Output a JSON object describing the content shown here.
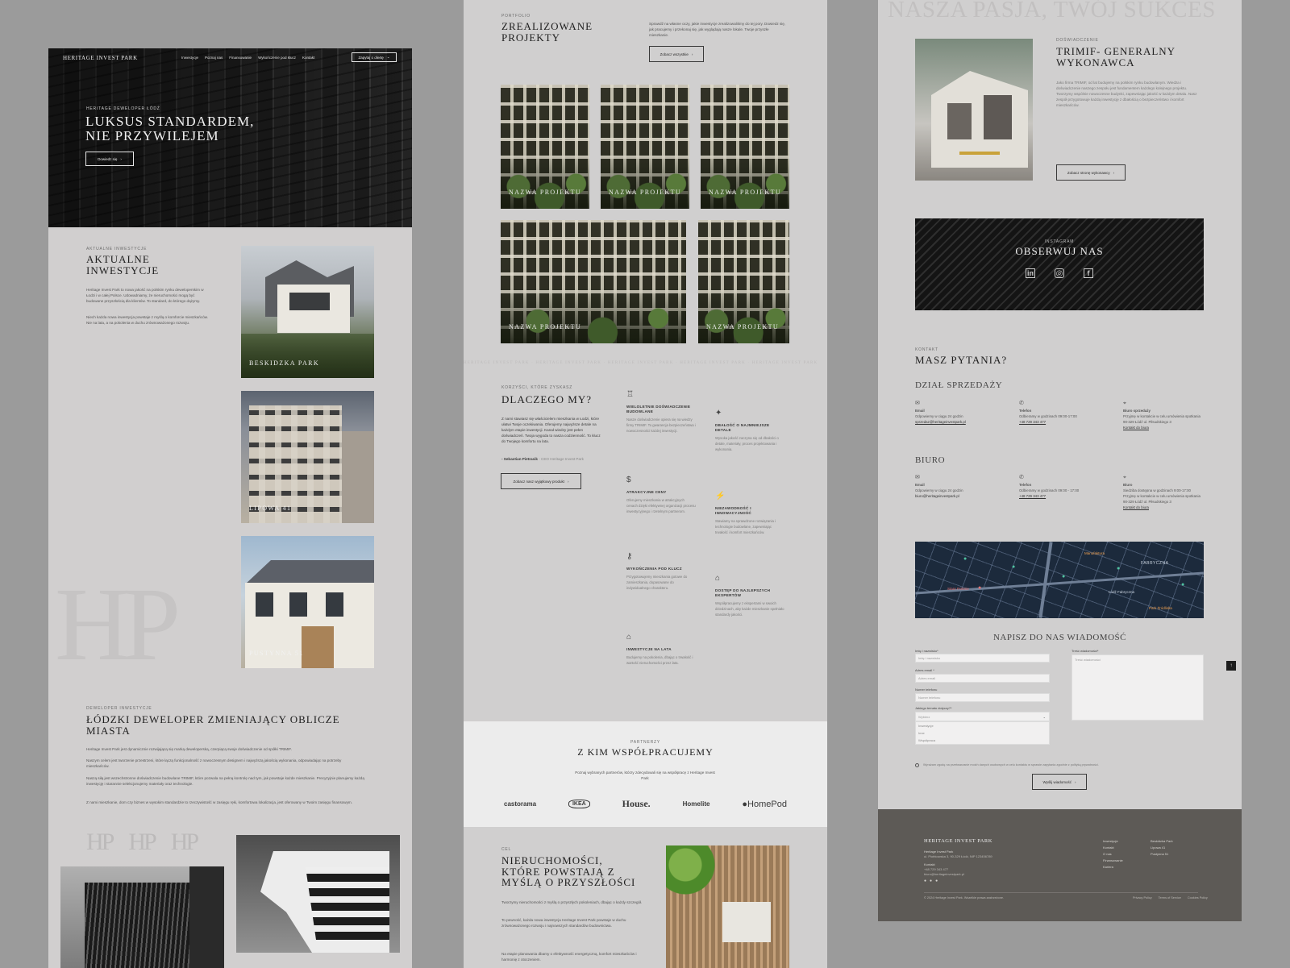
{
  "col1": {
    "header": {
      "logo": "HERITAGE INVEST PARK",
      "nav": [
        "Inwestycje",
        "Poznaj nas",
        "Finansowanie",
        "Wykończenie pod klucz",
        "Kontakt"
      ],
      "cta": "Zapytaj o ofertę"
    },
    "hero": {
      "eyebrow": "HERITAGE DEWELOPER ŁÓDŹ",
      "title_line1": "LUKSUS STANDARDEM,",
      "title_line2": "NIE PRZYWILEJEM",
      "button": "Dowiedz się"
    },
    "current": {
      "eyebrow": "AKTUALNE INWESTYCJE",
      "title_line1": "AKTUALNE",
      "title_line2": "INWESTYCJE",
      "p1": "Heritage Invest Park to nowa jakość na polskim rynku deweloperskim w Łodzi i w całej Polsce. Udowadniamy, że nieruchomości mogą być budowane przyszłością dla klientów. To standard, do którego dążymy.",
      "p2": "Niech każda nowa inwestycja powstaje z myślą o komforcie mieszkańców. Nie na lata, a na pokolenia w duchu zrównoważonego rozwoju.",
      "projects": [
        "BESKIDZKA PARK",
        "LIPOWA 41",
        "PUSTYNNA 51"
      ]
    },
    "developer": {
      "eyebrow": "DEWELOPER INWESTYCJE",
      "title_line1": "ŁÓDZKI DEWELOPER ZMIENIAJĄCY OBLICZE",
      "title_line2": "MIASTA",
      "p1": "Heritage Invest Park jest dynamicznie rozwijającą się marką deweloperską, czerpiącą swoje doświadczenie od spółki TRIMIF.",
      "p2": "Naszym celem jest tworzenie przestrzeni, które łączą funkcjonalność z nowoczesnym designem i najwyższą jakością wykonania, odpowiadając na potrzeby mieszkańców.",
      "p3": "Naszą siłą jest wszechstronne doświadczenie budowlane TRIMIF, które pozwala na pełną kontrolę nad tym, jak powstaje każde mieszkanie. Precyzyjnie planujemy każdą inwestycję i starannie selekcjonujemy materiały oraz technologie.",
      "p4": "Z nami mieszkanie, dom czy biznes w wysokim standardzie to rzeczywistość w zasięgu ręki, komfortowa lokalizacja, jest oferowany w Twoim zasięgu finansowym.",
      "monogram": "HP"
    }
  },
  "col2": {
    "portfolio": {
      "eyebrow": "PORTFOLIO",
      "title_line1": "ZREALIZOWANE",
      "title_line2": "PROJEKTY",
      "desc": "Sprawdź na własne oczy, jakie inwestycje zrealizowaliśmy do tej pory. Dowiedz się, jak pracujemy i przekonaj się, jak wyglądają nasze lokale. Twoje przyszłe mieszkanie.",
      "button": "Zobacz wszystkie",
      "tiles": [
        "NAZWA PROJEKTU",
        "NAZWA PROJEKTU",
        "NAZWA PROJEKTU",
        "NAZWA PROJEKTU",
        "NAZWA PROJEKTU"
      ]
    },
    "ticker": "HERITAGE INVEST PARK · HERITAGE INVEST PARK · HERITAGE INVEST PARK · HERITAGE INVEST PARK · HERITAGE INVEST PARK",
    "why": {
      "eyebrow": "KORZYŚCI, KTÓRE ZYSKASZ",
      "title": "DLACZEGO MY?",
      "quote": "Z nami stawiasz się właścicielem mieszkania w Łodzi, które ułatwi Twoje oczekiwania. Oferujemy najwyższe detale na każdym etapie inwestycji. Kanał wiedzy jest pełen doświadczeń. Twoja wygoda to nasza codzienność. To klucz do Twojego komfortu na lata.",
      "author": "- Sebastian Pietrasik",
      "author_role": "- CEO Heritage Invest Park",
      "button": "Zobacz nasz wyjątkowy produkt",
      "features": [
        {
          "icon": "award-icon",
          "glyph": "♖",
          "title": "WIELOLETNIE DOŚWIADCZENIE BUDOWLANE",
          "desc": "Nasze doświadczenie opiera się na wiedzy firmy TRIMIF. To gwarancja bezpieczeństwa i nowoczesności każdej inwestycji."
        },
        {
          "icon": "sparkle-icon",
          "glyph": "✦",
          "title": "DBAŁOŚĆ O NAJMNIEJSZE DETALE",
          "desc": "Wysoka jakość zaczyna się od dbałości o detale, materiały, proces projektowania i wykonania."
        },
        {
          "icon": "coin-icon",
          "glyph": "$",
          "title": "ATRAKCYJNE CENY",
          "desc": "Oferujemy mieszkania w atrakcyjnych cenach dzięki efektywnej organizacji procesu inwestycyjnego i rzetelnym partnerom."
        },
        {
          "icon": "bolt-icon",
          "glyph": "⚡",
          "title": "NIEZAWODNOŚĆ I INNOWACYJNOŚĆ",
          "desc": "Stawiamy na sprawdzone rozwiązania i technologie budowlane, zapewniając trwałość i komfort mieszkańców."
        },
        {
          "icon": "key-icon",
          "glyph": "⚷",
          "title": "WYKOŃCZENIA POD KLUCZ",
          "desc": "Przygotowujemy mieszkania gotowe do zamieszkania, dopasowane do indywidualnego charakteru."
        },
        {
          "icon": "helmet-icon",
          "glyph": "⌂",
          "title": "DOSTĘP DO NAJLEPSZYCH EKSPERTÓW",
          "desc": "Współpracujemy z ekspertami w swoich dziedzinach, aby każde mieszkanie spełniało standardy jakości."
        },
        {
          "icon": "house-icon",
          "glyph": "⌂",
          "title": "INWESTYCJE NA LATA",
          "desc": "Budujemy na pokolenia, dbając o trwałość i wartość nieruchomości przez lata."
        }
      ]
    },
    "partners": {
      "eyebrow": "PARTNERZY",
      "title": "Z KIM WSPÓŁPRACUJEMY",
      "desc": "Poznaj wybranych partnerów, którzy zdecydowali się na współpracę z Heritage Invest Park",
      "logos": [
        "castorama",
        "IKEA",
        "House.",
        "Homelite",
        "HomePod"
      ]
    },
    "future": {
      "eyebrow": "CEL",
      "title_line1": "NIERUCHOMOŚCI,",
      "title_line2": "KTÓRE POWSTAJĄ Z",
      "title_line3": "MYŚLĄ O PRZYSZŁOŚCI",
      "p1": "Tworzymy nieruchomości z myślą o przyszłych pokoleniach, dbając o każdy szczegół.",
      "p2": "To pewność, każda nowa inwestycja Heritage Invest Park powstaje w duchu zrównoważonego rozwoju i najnowszych standardów budownictwa.",
      "p3": "Na etapie planowania dbamy o efektywność energetyczną, komfort mieszkańców i harmonię z otoczeniem."
    }
  },
  "col3": {
    "watermark": "NASZA PASJA, TWÓJ SUKCES",
    "trimif": {
      "eyebrow": "DOŚWIADCZENIE",
      "title_line1": "TRIMIF- GENERALNY",
      "title_line2": "WYKONAWCA",
      "desc": "Jako firma TRIMIF, od lat budujemy na polskim rynku budowlanym. Wiedza i doświadczenie naszego zespołu jest fundamentem każdego kolejnego projektu. Tworzymy wspólnie nowoczesne budynki, zapewniając jakość w każdym detalu. Nasz zespół przygotowuje każdą inwestycję z dbałością o bezpieczeństwo i komfort mieszkańców.",
      "button": "Zobacz stronę wykonawcy"
    },
    "social": {
      "eyebrow": "INSTAGRAM",
      "title": "OBSERWUJ NAS",
      "icons": [
        "linkedin-icon",
        "instagram-icon",
        "facebook-icon"
      ],
      "glyphs": [
        "in",
        "◎",
        "f"
      ]
    },
    "contact": {
      "eyebrow": "KONTAKT",
      "title": "MASZ PYTANIA?",
      "sales": {
        "title": "DZIAŁ SPRZEDAŻY",
        "email_label": "Email",
        "email_text": "Odpowiemy w ciągu 24 godzin",
        "email_value": "sprzedaz@heritageinvestpark.pl",
        "phone_label": "Telefon",
        "phone_text": "Odbieramy w godzinach 09:00-17:00",
        "phone_value": "+48 729 343 477",
        "office_label": "Biuro sprzedaży",
        "office_text": "Przyjmę w kontakcie w celu umówienia spotkania",
        "office_address": "90-329 Łódź ul. Piłsudskiego 3",
        "office_link": "Kontakt do biura"
      },
      "office": {
        "title": "BIURO",
        "email_label": "Email",
        "email_text": "Odpowiemy w ciągu 24 godzin",
        "email_value": "biuro@heritageinvestpark.pl",
        "phone_label": "Telefon",
        "phone_text": "Odbieramy w godzinach 09:00 - 17:00",
        "phone_value": "+48 729 343 477",
        "office_label": "Biuro",
        "office_hours": "Siedziba dostępna w godzinach 9:00-17:00",
        "office_text": "Przyjmę w kontakcie w celu umówienia spotkania",
        "office_address": "90-329 Łódź ul. Piłsudskiego 3",
        "office_link": "Kontakt do biura"
      }
    },
    "map_labels": [
      "Manufaktura",
      "FABRYCZNA",
      "Łódź Fabryczna",
      "Stare Polesie",
      "Park Źródliska"
    ],
    "form": {
      "title": "NAPISZ DO NAS WIADOMOŚĆ",
      "name_label": "Imię i nazwisko*",
      "name_placeholder": "Imię i nazwisko",
      "email_label": "Adres email *",
      "email_placeholder": "Adres email",
      "phone_label": "Numer telefonu",
      "phone_placeholder": "Numer telefonu",
      "topic_label": "Jakiego tematu dotyczy?*",
      "topic_value": "Wybierz",
      "topic_options": [
        "Inwestycje",
        "Inne",
        "Współpraca"
      ],
      "message_label": "Treść wiadomości*",
      "message_placeholder": "Treść wiadomości",
      "consent": "Wyrażam zgodę na przetwarzanie moich danych osobowych w celu kontaktu w sprawie zapytania zgodnie z polityką prywatności.",
      "submit": "Wyślij wiadomość"
    },
    "footer": {
      "logo": "HERITAGE INVEST PARK",
      "company": "Heritage Invest Park",
      "address": "ul. Piotrkowska 3, 90-329 Łódź, NIP 123456789",
      "contact_title": "Kontakt",
      "phone": "+48 729 343 477",
      "email": "biuro@heritageinvestpark.pl",
      "links1": [
        "Inwestycje",
        "Kontakt",
        "O nas",
        "Finansowanie",
        "Kariera"
      ],
      "links2": [
        "Beskidzka Park",
        "Lipowa 41",
        "Pustynna 51"
      ],
      "copyright": "© 2024 Heritage Invest Park. Wszelkie prawa zastrzeżone.",
      "legal": [
        "Privacy Policy",
        "Terms of Service",
        "Cookies Policy"
      ]
    }
  }
}
